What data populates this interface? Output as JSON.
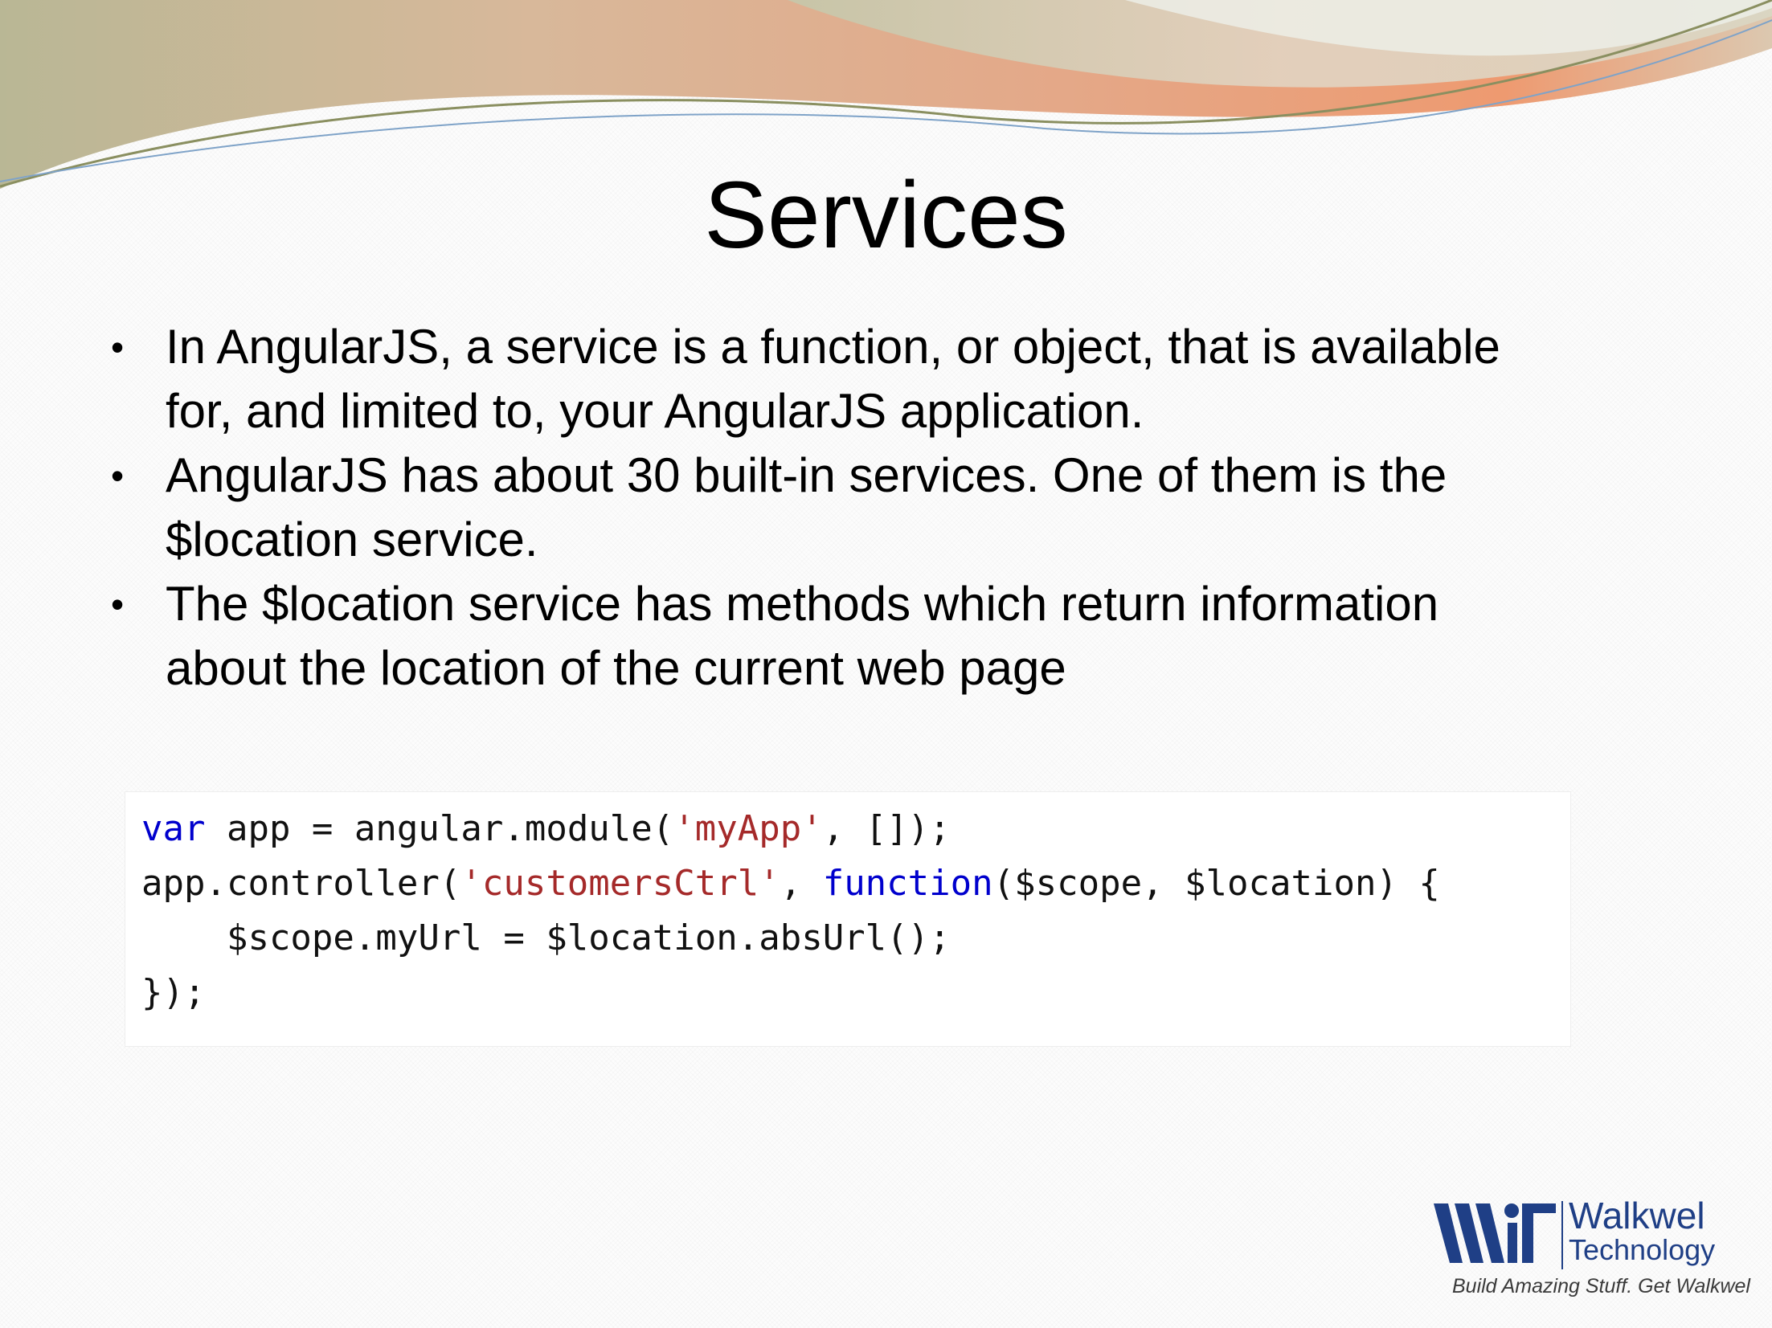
{
  "slide": {
    "title": "Services",
    "bullets": [
      {
        "line1": "In AngularJS, a service is a function, or object, that is available",
        "line2": "for, and limited to, your AngularJS application."
      },
      {
        "line1": "AngularJS has about 30 built-in services. One of them is the",
        "line2": "$location service."
      },
      {
        "line1": "The $location service has methods which return information",
        "line2": "about the location of the current web page"
      }
    ],
    "bullet_glyph": "•"
  },
  "code": {
    "line1": {
      "kw": "var",
      "a": " app = angular.module(",
      "str": "'myApp'",
      "b": ", []);"
    },
    "line2": {
      "a": "app.controller(",
      "str": "'customersCtrl'",
      "b": ", ",
      "kw": "function",
      "c": "($scope, $location) {"
    },
    "line3": "    $scope.myUrl = $location.absUrl();",
    "line4": "});"
  },
  "logo": {
    "name_line1": "Walkwel",
    "name_line2": "Technology",
    "tagline": "Build Amazing Stuff. Get Walkwel"
  },
  "colors": {
    "keyword": "#0000cd",
    "string": "#a52a2a",
    "brand_blue": "#1f3f86",
    "swoosh_peach": "#e8a070",
    "swoosh_sage": "#c8c9a8"
  }
}
